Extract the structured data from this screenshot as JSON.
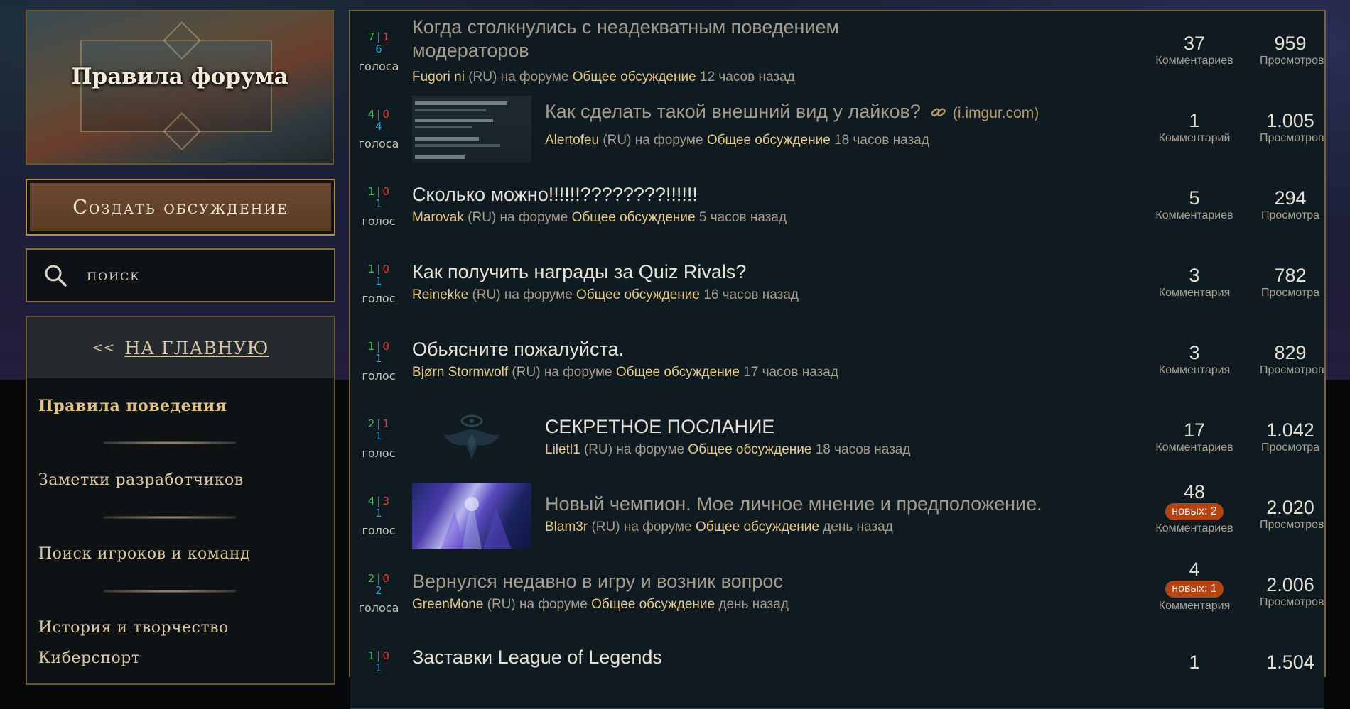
{
  "sidebar": {
    "rules_banner": "Правила форума",
    "create_button": "Создать обсуждение",
    "search_placeholder": "поиск",
    "home_arrows": "<<",
    "home_link": "НА ГЛАВНУЮ",
    "nav_items": [
      "Правила поведения",
      "Заметки разработчиков",
      "Поиск игроков и команд",
      "История и творчество",
      "Киберспорт"
    ]
  },
  "threads": [
    {
      "up": "7",
      "down": "1",
      "total": "6",
      "vote_label": "голоса",
      "title1": "Когда столкнулись с неадекватным поведением",
      "title2": "модераторов",
      "author": "Fugori ni",
      "region": "(RU)",
      "on_forum": "на форуме",
      "forum": "Общее обсуждение",
      "time": "12 часов назад",
      "comments": "37",
      "comments_label": "Комментариев",
      "views": "959",
      "views_label": "Просмотров"
    },
    {
      "up": "4",
      "down": "0",
      "total": "4",
      "vote_label": "голоса",
      "title1": "Как сделать такой внешний вид у лайков?",
      "link_host": "(i.imgur.com)",
      "author": "Alertofeu",
      "region": "(RU)",
      "on_forum": "на форуме",
      "forum": "Общее обсуждение",
      "time": "18 часов назад",
      "comments": "1",
      "comments_label": "Комментарий",
      "views": "1.005",
      "views_label": "Просмотров"
    },
    {
      "up": "1",
      "down": "0",
      "total": "1",
      "vote_label": "голос",
      "title1": "Сколько можно!!!!!!????????!!!!!!",
      "author": "Marovak",
      "region": "(RU)",
      "on_forum": "на форуме",
      "forum": "Общее обсуждение",
      "time": "5 часов назад",
      "comments": "5",
      "comments_label": "Комментариев",
      "views": "294",
      "views_label": "Просмотра"
    },
    {
      "up": "1",
      "down": "0",
      "total": "1",
      "vote_label": "голос",
      "title1": "Как получить награды за Quiz Rivals?",
      "author": "Reinekke",
      "region": "(RU)",
      "on_forum": "на форуме",
      "forum": "Общее обсуждение",
      "time": "16 часов назад",
      "comments": "3",
      "comments_label": "Комментария",
      "views": "782",
      "views_label": "Просмотра"
    },
    {
      "up": "1",
      "down": "0",
      "total": "1",
      "vote_label": "голос",
      "title1": "Обьясните пожалуйста.",
      "author": "Bjørn Stormwolf",
      "region": "(RU)",
      "on_forum": "на форуме",
      "forum": "Общее обсуждение",
      "time": "17 часов назад",
      "comments": "3",
      "comments_label": "Комментария",
      "views": "829",
      "views_label": "Просмотров"
    },
    {
      "up": "2",
      "down": "1",
      "total": "1",
      "vote_label": "голос",
      "title1": "СЕКРЕТНОЕ ПОСЛАНИЕ",
      "author": "Liletl1",
      "region": "(RU)",
      "on_forum": "на форуме",
      "forum": "Общее обсуждение",
      "time": "18 часов назад",
      "comments": "17",
      "comments_label": "Комментариев",
      "views": "1.042",
      "views_label": "Просмотра"
    },
    {
      "up": "4",
      "down": "3",
      "total": "1",
      "vote_label": "голос",
      "title1": "Новый чемпион. Мое личное мнение и предположение.",
      "author": "Blam3r",
      "region": "(RU)",
      "on_forum": "на форуме",
      "forum": "Общее обсуждение",
      "time": "день назад",
      "comments": "48",
      "new_badge": "новых: 2",
      "comments_label": "Комментариев",
      "views": "2.020",
      "views_label": "Просмотров"
    },
    {
      "up": "2",
      "down": "0",
      "total": "2",
      "vote_label": "голоса",
      "title1": "Вернулся недавно в игру и возник вопрос",
      "author": "GreenMone",
      "region": "(RU)",
      "on_forum": "на форуме",
      "forum": "Общее обсуждение",
      "time": "день назад",
      "comments": "4",
      "new_badge": "новых: 1",
      "comments_label": "Комментария",
      "views": "2.006",
      "views_label": "Просмотров"
    },
    {
      "up": "1",
      "down": "0",
      "total": "1",
      "title1": "Заставки League of Legends",
      "comments": "1",
      "views": "1.504"
    }
  ],
  "colors": {
    "accent_gold": "#e6c98a",
    "vote_up": "#41b957",
    "vote_down": "#d6403d",
    "vote_total": "#28a9d6",
    "badge": "#b34515"
  },
  "icons": [
    "search-icon",
    "link-icon"
  ]
}
